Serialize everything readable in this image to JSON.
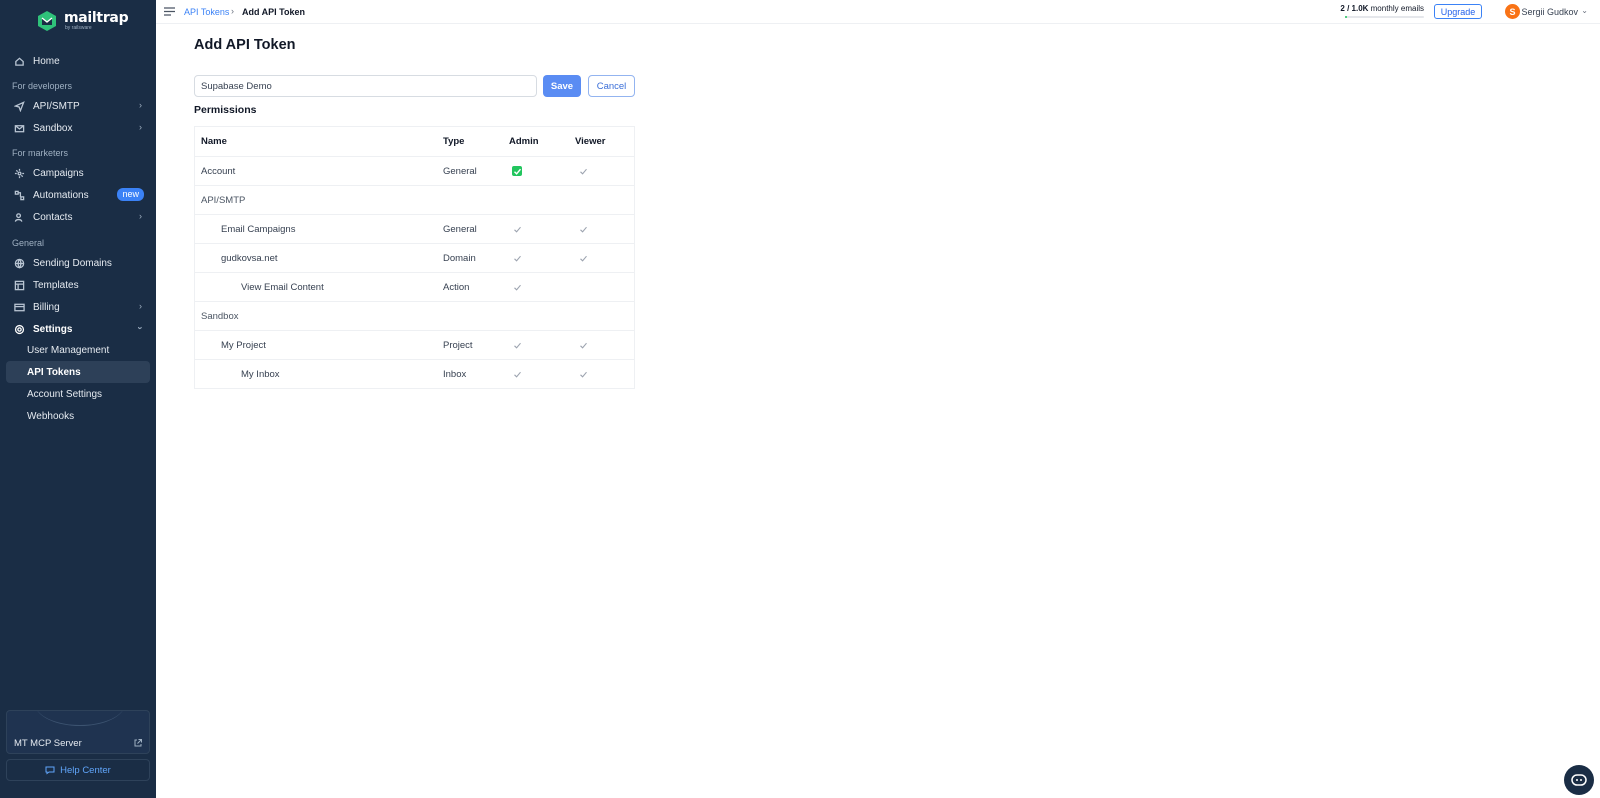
{
  "brand": {
    "name": "mailtrap",
    "sub": "by railsware"
  },
  "sidebar": {
    "home": "Home",
    "section_developers": "For developers",
    "api_smtp": "API/SMTP",
    "sandbox": "Sandbox",
    "section_marketers": "For marketers",
    "campaigns": "Campaigns",
    "automations": "Automations",
    "automations_badge": "new",
    "contacts": "Contacts",
    "section_general": "General",
    "sending_domains": "Sending Domains",
    "templates": "Templates",
    "billing": "Billing",
    "settings": "Settings",
    "settings_items": [
      "User Management",
      "API Tokens",
      "Account Settings",
      "Webhooks"
    ],
    "mcp_label": "MT MCP Server",
    "help_center": "Help Center"
  },
  "topbar": {
    "breadcrumb_parent": "API Tokens",
    "breadcrumb_sep": "›",
    "breadcrumb_current": "Add API Token",
    "usage_count": "2 / 1.0K",
    "usage_label": " monthly emails",
    "usage_fraction": 0.002,
    "upgrade": "Upgrade",
    "avatar_initial": "S",
    "user_name": "Sergii Gudkov"
  },
  "main": {
    "title": "Add API Token",
    "token_name_value": "Supabase Demo",
    "save": "Save",
    "cancel": "Cancel",
    "permissions_heading": "Permissions",
    "columns": {
      "name": "Name",
      "type": "Type",
      "admin": "Admin",
      "viewer": "Viewer"
    },
    "rows": [
      {
        "name": "Account",
        "type": "General",
        "admin": "checked",
        "viewer": "tick"
      },
      {
        "name": "API/SMTP",
        "type": "",
        "admin": "",
        "viewer": ""
      },
      {
        "name": "Email Campaigns",
        "type": "General",
        "admin": "tick",
        "viewer": "tick"
      },
      {
        "name": "gudkovsa.net",
        "type": "Domain",
        "admin": "tick",
        "viewer": "tick"
      },
      {
        "name": "View Email Content",
        "type": "Action",
        "admin": "tick",
        "viewer": ""
      },
      {
        "name": "Sandbox",
        "type": "",
        "admin": "",
        "viewer": ""
      },
      {
        "name": "My Project",
        "type": "Project",
        "admin": "tick",
        "viewer": "tick"
      },
      {
        "name": "My Inbox",
        "type": "Inbox",
        "admin": "tick",
        "viewer": "tick"
      }
    ]
  },
  "colors": {
    "sidebar": "#1a2d45",
    "accent": "#3b82f6",
    "save": "#5a8cf3",
    "checked": "#22c55e",
    "avatar": "#f97316"
  }
}
